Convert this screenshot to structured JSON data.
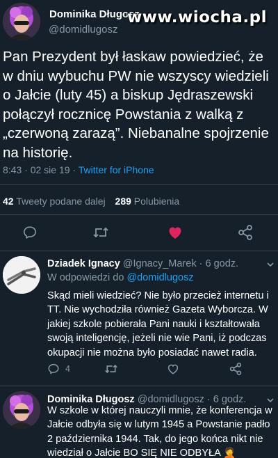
{
  "watermark": "www.wiocha.pl",
  "main_tweet": {
    "display_name": "Dominika Długosz",
    "handle": "@domidlugosz",
    "lines": [
      "Pan Prezydent był łaskaw powiedzieć, że",
      "w dniu wybuchu PW nie wszyscy wiedzieli",
      "o Jałcie (luty 45) a biskup Jędraszewski",
      "połączył rocznicę Powstania z walką z",
      "„czerwoną zarazą”. Niebanalne spojrzenie",
      "na historię."
    ],
    "timestamp": "8:43 · 02 sie 19 · ",
    "client": "Twitter for iPhone",
    "retweets_count": "42",
    "retweets_label": "Tweety podane dalej",
    "likes_count": "289",
    "likes_label": "Polubienia"
  },
  "replies": [
    {
      "display_name": "Dziadek Ignacy",
      "meta": "@Ignacy_Marek · 6 godz.",
      "reply_to_prefix": "W odpowiedzi do ",
      "reply_to_handle": "@domidlugosz",
      "lines": [
        "Skąd mieli wiedzieć? Nie było przecież internetu i",
        "TT. Nie wychodziła również Gazeta Wyborcza. W",
        "jakiej szkole pobierała Pani nauki i kształtowała",
        "swoją inteligencję, jeżeli nie wie Pani, iż podczas",
        "okupacji nie można było posiadać nawet radia."
      ],
      "reply_count": "4"
    },
    {
      "display_name": "Dominika Długosz",
      "meta": "@domidlugosz · 6 godz.",
      "lines": [
        "W szkole w której nauczyli mnie, że konferencja w",
        "Jałcie odbyła się w lutym 1945 a Powstanie padło",
        "2 października 1944. Tak, do jego końca nikt nie",
        "wiedział o Jałcie BO SIĘ NIE ODBYŁA 🤦"
      ]
    }
  ],
  "icons": {
    "reply": "comment-icon",
    "retweet": "retweet-icon",
    "like": "heart-icon",
    "share": "share-icon"
  },
  "colors": {
    "background": "#15202b",
    "accent": "#1da1f2",
    "muted": "#8899a6",
    "like": "#e0245e",
    "divider": "#38444d"
  }
}
